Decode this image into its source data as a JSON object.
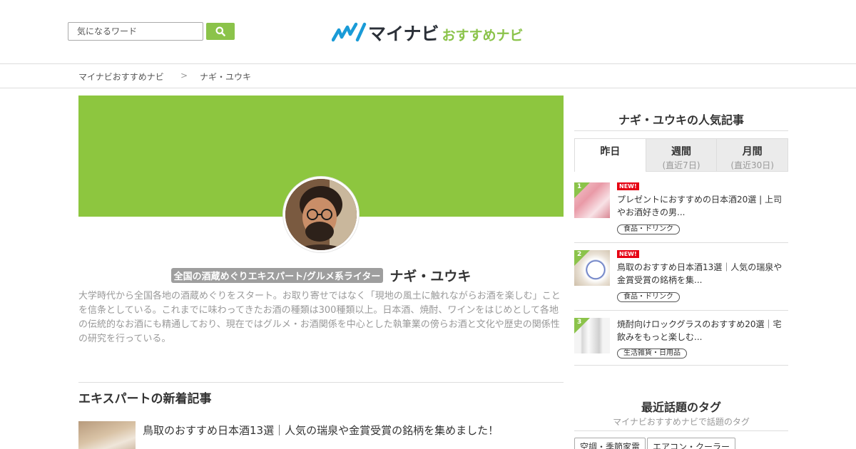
{
  "header": {
    "search_placeholder": "気になるワード",
    "logo_main": "マイナビ",
    "logo_sub": "おすすめナビ",
    "accent_color": "#8bc34a"
  },
  "breadcrumb": {
    "home": "マイナビおすすめナビ",
    "separator": ">",
    "current": "ナギ・ユウキ"
  },
  "profile": {
    "badge": "全国の酒蔵めぐりエキスパート/グルメ系ライター",
    "name": "ナギ・ユウキ",
    "bio": "大学時代から全国各地の酒蔵めぐりをスタート。お取り寄せではなく「現地の風土に触れながらお酒を楽しむ」ことを信条としている。これまでに味わってきたお酒の種類は300種類以上。日本酒、焼酎、ワインをはじめとして各地の伝統的なお酒にも精通しており、現在ではグルメ・お酒関係を中心とした執筆業の傍らお酒と文化や歴史の関係性の研究を行っている。",
    "cover_color": "#8dc63f"
  },
  "new_articles": {
    "title": "エキスパートの新着記事",
    "items": [
      {
        "title": "鳥取のおすすめ日本酒13選｜人気の瑞泉や金賞受賞の銘柄を集めました！"
      }
    ]
  },
  "sidebar": {
    "popular_title": "ナギ・ユウキの人気記事",
    "tabs": [
      {
        "label": "昨日",
        "sub": ""
      },
      {
        "label": "週間",
        "sub": "(直近7日)"
      },
      {
        "label": "月間",
        "sub": "(直近30日)"
      }
    ],
    "ranking": [
      {
        "rank": "1",
        "new": "NEW!",
        "title": "プレゼントにおすすめの日本酒20選 | 上司やお酒好きの男...",
        "category": "食品・ドリンク"
      },
      {
        "rank": "2",
        "new": "NEW!",
        "title": "鳥取のおすすめ日本酒13選｜人気の瑞泉や金賞受賞の銘柄を集...",
        "category": "食品・ドリンク"
      },
      {
        "rank": "3",
        "new": "",
        "title": "焼酎向けロックグラスのおすすめ20選｜宅飲みをもっと楽しむ...",
        "category": "生活雑貨・日用品"
      }
    ],
    "tags_title": "最近話題のタグ",
    "tags_sub": "マイナビおすすめナビで話題のタグ",
    "tags": [
      "空調・季節家電",
      "エアコン・クーラー"
    ]
  }
}
